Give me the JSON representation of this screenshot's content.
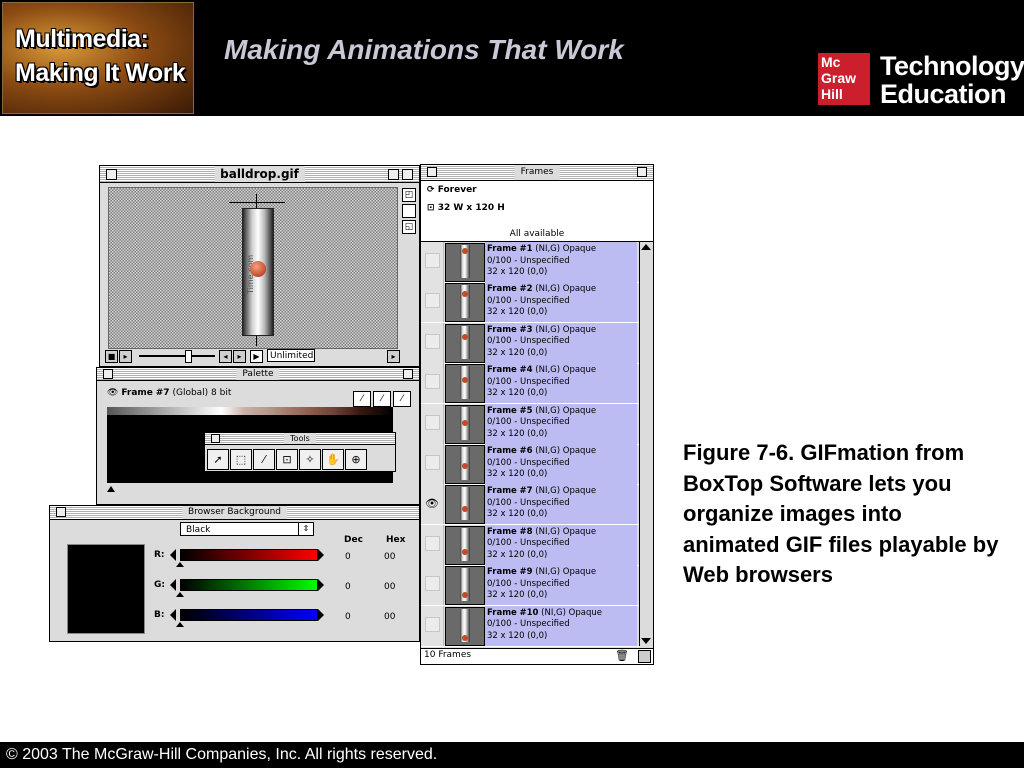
{
  "slide": {
    "logo_line1": "Multimedia:",
    "logo_line2": "Making It Work",
    "title": "Making Animations That Work",
    "publisher_logo": [
      "Mc",
      "Graw",
      "Hill"
    ],
    "brand_line1": "Technology",
    "brand_line2": "Education",
    "caption": "Figure 7-6. GIFmation from BoxTop Software lets you organize images into animated GIF files playable by Web browsers",
    "footer": "© 2003 The McGraw-Hill Companies, Inc. All rights reserved."
  },
  "balldrop_window": {
    "title": "balldrop.gif",
    "loop_field": "Unlimited",
    "tube_label": "Time.com"
  },
  "palette_window": {
    "title": "Palette",
    "frame_label": "Frame",
    "frame_num": "#7",
    "frame_info": "(Global) 8 bit"
  },
  "tools_window": {
    "title": "Tools"
  },
  "browser_background_window": {
    "title": "Browser Background",
    "color_select": "Black",
    "dec_header": "Dec",
    "hex_header": "Hex",
    "channels": [
      {
        "label": "R:",
        "dec": "0",
        "hex": "00"
      },
      {
        "label": "G:",
        "dec": "0",
        "hex": "00"
      },
      {
        "label": "B:",
        "dec": "0",
        "hex": "00"
      }
    ]
  },
  "frames_window": {
    "title": "Frames",
    "loop": "Forever",
    "size": "32 W x 120 H",
    "palette_mode": "All available",
    "footer_count": "10 Frames",
    "frames": [
      {
        "name": "Frame",
        "num": "#1",
        "flags": "(NI,G) Opaque",
        "delay": "0/100 - Unspecified",
        "geom": "32 x 120 (0,0)"
      },
      {
        "name": "Frame",
        "num": "#2",
        "flags": "(NI,G) Opaque",
        "delay": "0/100 - Unspecified",
        "geom": "32 x 120 (0,0)"
      },
      {
        "name": "Frame",
        "num": "#3",
        "flags": "(NI,G) Opaque",
        "delay": "0/100 - Unspecified",
        "geom": "32 x 120 (0,0)"
      },
      {
        "name": "Frame",
        "num": "#4",
        "flags": "(NI,G) Opaque",
        "delay": "0/100 - Unspecified",
        "geom": "32 x 120 (0,0)"
      },
      {
        "name": "Frame",
        "num": "#5",
        "flags": "(NI,G) Opaque",
        "delay": "0/100 - Unspecified",
        "geom": "32 x 120 (0,0)"
      },
      {
        "name": "Frame",
        "num": "#6",
        "flags": "(NI,G) Opaque",
        "delay": "0/100 - Unspecified",
        "geom": "32 x 120 (0,0)"
      },
      {
        "name": "Frame",
        "num": "#7",
        "flags": "(NI,G) Opaque",
        "delay": "0/100 - Unspecified",
        "geom": "32 x 120 (0,0)"
      },
      {
        "name": "Frame",
        "num": "#8",
        "flags": "(NI,G) Opaque",
        "delay": "0/100 - Unspecified",
        "geom": "32 x 120 (0,0)"
      },
      {
        "name": "Frame",
        "num": "#9",
        "flags": "(NI,G) Opaque",
        "delay": "0/100 - Unspecified",
        "geom": "32 x 120 (0,0)"
      },
      {
        "name": "Frame",
        "num": "#10",
        "flags": "(NI,G) Opaque",
        "delay": "0/100 - Unspecified",
        "geom": "32 x 120 (0,0)"
      }
    ]
  },
  "colors": {
    "frame_row_bg": "#bcbcf2",
    "mh_red": "#cc1f2e",
    "header_title": "#c9c9d6"
  }
}
